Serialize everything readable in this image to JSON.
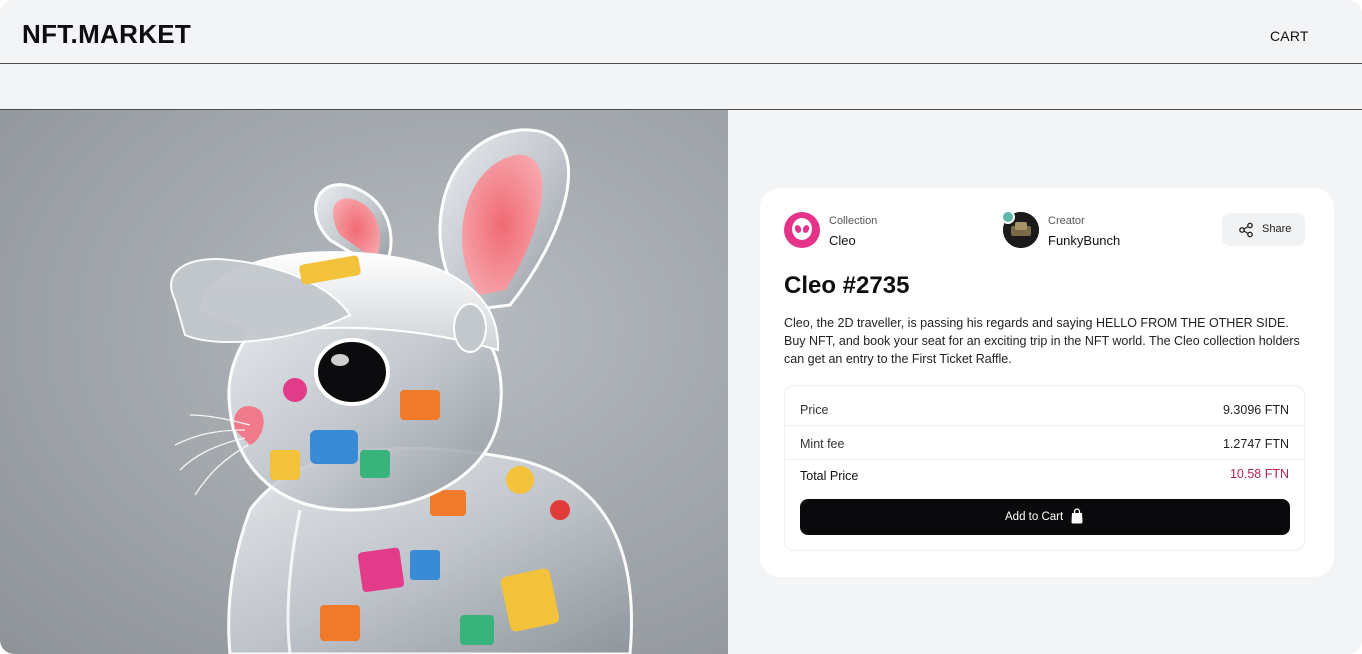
{
  "header": {
    "logo": "NFT.MARKET",
    "cart_label": "CART"
  },
  "artwork": {
    "icon": "rabbit-artwork"
  },
  "card": {
    "collection": {
      "label": "Collection",
      "name": "Cleo"
    },
    "creator": {
      "label": "Creator",
      "name": "FunkyBunch",
      "verified": true
    },
    "share_label": "Share",
    "title": "Cleo #2735",
    "description": "Cleo, the 2D traveller, is passing his regards and saying HELLO FROM THE OTHER SIDE. Buy NFT, and book your seat for an exciting trip in the NFT world. The Cleo collection holders can get an entry to the First Ticket Raffle.",
    "pricing": {
      "price_label": "Price",
      "price_value": "9.3096 FTN",
      "fee_label": "Mint fee",
      "fee_value": "1.2747 FTN",
      "total_label": "Total Price",
      "total_value": "10.58 FTN"
    },
    "add_to_cart_label": "Add to Cart"
  },
  "colors": {
    "accent_total": "#b1244f",
    "collection_avatar": "#e5338a",
    "button_bg": "#0a0a0d"
  }
}
